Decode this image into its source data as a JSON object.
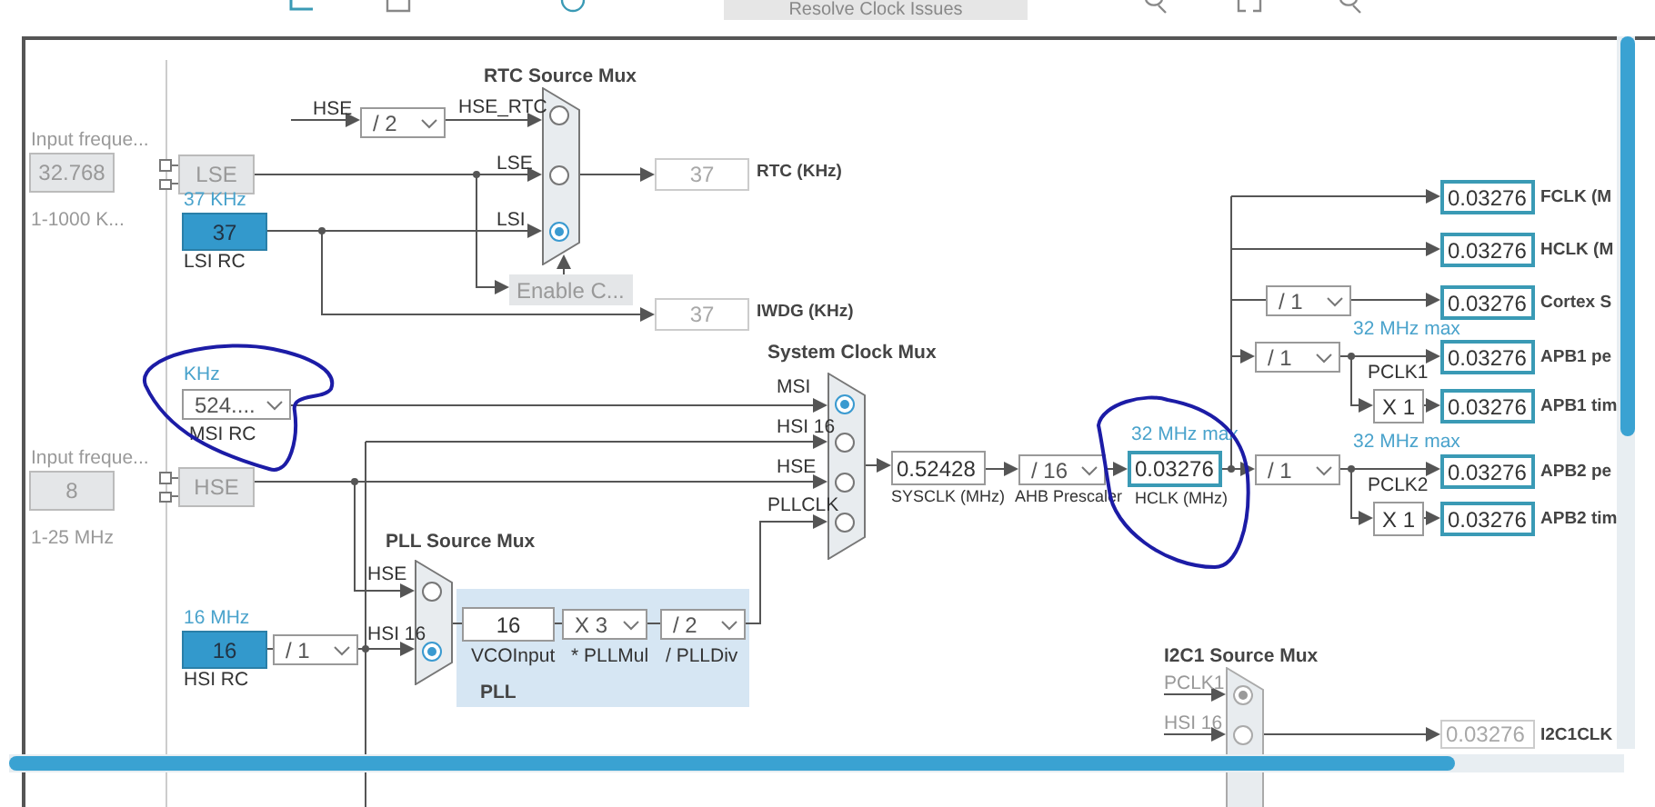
{
  "toolbar": {
    "button": "Resolve Clock Issues"
  },
  "external_inputs": [
    {
      "label": "Input freque...",
      "value": "32.768",
      "range": "1-1000 K...",
      "source": "LSE",
      "disabled": true
    },
    {
      "label": "Input freque...",
      "value": "8",
      "range": "1-25 MHz",
      "source": "HSE",
      "disabled": true
    }
  ],
  "rc_oscillators": [
    {
      "frequency": "37 KHz",
      "value": "37",
      "name": "LSI RC"
    },
    {
      "frequency": "16 MHz",
      "value": "16",
      "name": "HSI RC"
    }
  ],
  "msi": {
    "unit": "KHz",
    "value": "524....",
    "name": "MSI RC"
  },
  "rtc": {
    "hse_label": "HSE",
    "divider": "/ 2",
    "enable_button": {
      "label": "Enable C...",
      "disabled": true
    },
    "outputs": [
      {
        "value": "37",
        "label": "RTC (KHz)",
        "disabled": true
      },
      {
        "value": "37",
        "label": "IWDG (KHz)",
        "disabled": true
      }
    ]
  },
  "muxes": [
    {
      "title": "RTC Source Mux",
      "disabled": false,
      "inputs": [
        {
          "label": "HSE_RTC",
          "selected": false
        },
        {
          "label": "LSE",
          "selected": false
        },
        {
          "label": "LSI",
          "selected": true
        }
      ]
    },
    {
      "title": "System Clock Mux",
      "disabled": false,
      "inputs": [
        {
          "label": "MSI",
          "selected": true
        },
        {
          "label": "HSI 16",
          "selected": false
        },
        {
          "label": "HSE",
          "selected": false
        },
        {
          "label": "PLLCLK",
          "selected": false
        }
      ]
    },
    {
      "title": "PLL Source Mux",
      "disabled": false,
      "inputs": [
        {
          "label": "HSE",
          "selected": false
        },
        {
          "label": "HSI 16",
          "selected": true
        }
      ]
    },
    {
      "title": "I2C1 Source Mux",
      "disabled": true,
      "inputs": [
        {
          "label": "PCLK1",
          "selected": true
        },
        {
          "label": "HSI 16",
          "selected": false
        }
      ]
    }
  ],
  "hsi_divider": "/ 1",
  "pll": {
    "title": "PLL",
    "input": {
      "value": "16",
      "label": "VCOInput"
    },
    "multiplier": {
      "value": "X 3",
      "label": "* PLLMul"
    },
    "divider": {
      "value": "/ 2",
      "label": "/ PLLDiv"
    }
  },
  "sysclk": {
    "value": "0.52428",
    "label": "SYSCLK (MHz)"
  },
  "ahb": {
    "value": "/ 16",
    "label": "AHB Prescaler"
  },
  "hclk": {
    "value": "0.03276",
    "label": "HCLK (MHz)",
    "limit": "32 MHz max"
  },
  "cortex_divider": "/ 1",
  "apb": [
    {
      "divider": "/ 1",
      "limit": "32 MHz max",
      "pclk": "PCLK1",
      "timer_multiplier": "X 1"
    },
    {
      "divider": "/ 1",
      "limit": "32 MHz max",
      "pclk": "PCLK2",
      "timer_multiplier": "X 1"
    }
  ],
  "outputs": [
    {
      "value": "0.03276",
      "label": "FCLK (M"
    },
    {
      "value": "0.03276",
      "label": "HCLK (M"
    },
    {
      "value": "0.03276",
      "label": "Cortex S"
    },
    {
      "value": "0.03276",
      "label": "APB1 pe"
    },
    {
      "value": "0.03276",
      "label": "APB1 tim"
    },
    {
      "value": "0.03276",
      "label": "APB2 pe"
    },
    {
      "value": "0.03276",
      "label": "APB2 tim"
    }
  ],
  "i2c1": {
    "value": "0.03276",
    "label": "I2C1CLK",
    "disabled": true
  }
}
